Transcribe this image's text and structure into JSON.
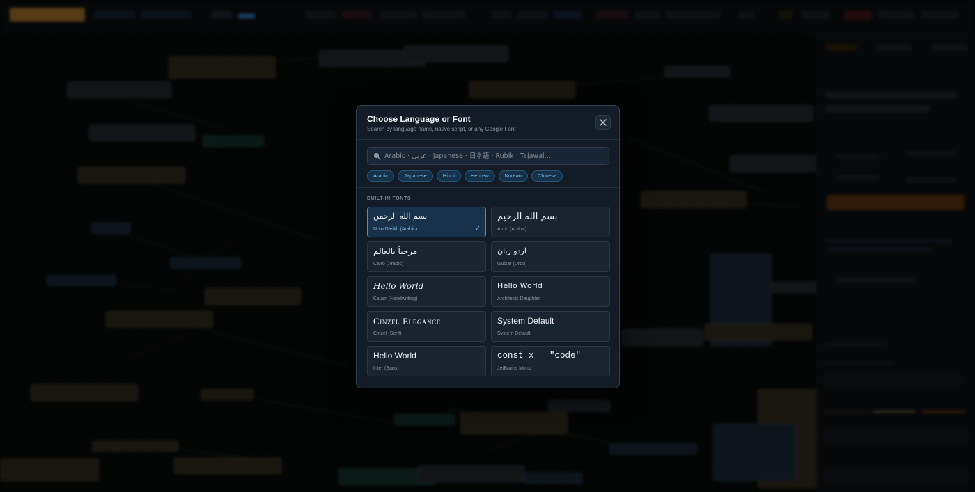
{
  "modal": {
    "title": "Choose Language or Font",
    "subtitle": "Search by language name, native script, or any Google Font",
    "search_placeholder": "Arabic · عربي · Japanese · 日本語 · Rubik · Tajawal...",
    "chips": [
      "Arabic",
      "Japanese",
      "Hindi",
      "Hebrew",
      "Korean",
      "Chinese"
    ],
    "section_label": "BUILT-IN FONTS",
    "fonts": [
      {
        "sample": "بسم الله الرحمن",
        "name": "Noto Naskh (Arabic)",
        "selected": true
      },
      {
        "sample": "بسم الله الرحيم",
        "name": "Amiri (Arabic)",
        "selected": false
      },
      {
        "sample": "مرحباً بالعالم",
        "name": "Cairo (Arabic)",
        "selected": false
      },
      {
        "sample": "اردو زبان",
        "name": "Gulzar (Urdu)",
        "selected": false
      },
      {
        "sample": "Hello World",
        "name": "Kalam (Handwriting)",
        "selected": false
      },
      {
        "sample": "Hello World",
        "name": "Architects Daughter",
        "selected": false
      },
      {
        "sample": "Cinzel Elegance",
        "name": "Cinzel (Serif)",
        "selected": false
      },
      {
        "sample": "System Default",
        "name": "System Default",
        "selected": false
      },
      {
        "sample": "Hello World",
        "name": "Inter (Sans)",
        "selected": false
      },
      {
        "sample": "const x = \"code\"",
        "name": "JetBrains Mono",
        "selected": false
      }
    ],
    "selected_mark": "✓"
  },
  "icons": {
    "close": "close-icon",
    "search": "search-icon",
    "check": "checkmark-icon"
  },
  "colors": {
    "accent": "#3c94d6",
    "chip_text": "#7cc0f0",
    "modal_bg": "#131c26"
  }
}
